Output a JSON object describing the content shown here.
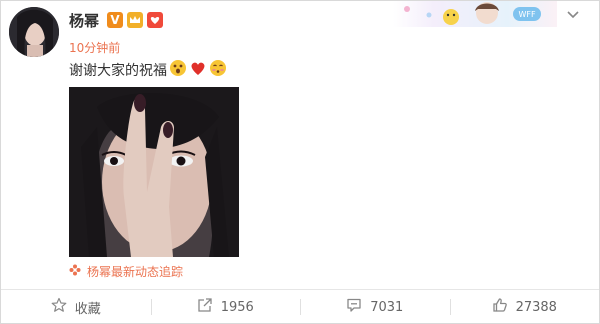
{
  "post": {
    "username": "杨幂",
    "verified_badge": "V",
    "timestamp": "10分钟前",
    "content_text": "谢谢大家的祝福",
    "emojis": [
      "shocked-face-emoji",
      "heart-emoji",
      "shy-face-emoji"
    ],
    "topic_text": "杨幂最新动态追踪"
  },
  "actions": {
    "favorite": "收藏",
    "repost": "1956",
    "comment": "7031",
    "like": "27388"
  },
  "colors": {
    "accent": "#eb7350",
    "verified": "#f08c1c",
    "heart": "#e0302a",
    "divider": "#e6e6e6",
    "action_text": "#666666"
  },
  "icons": [
    "chevron-down-icon",
    "star-icon",
    "repost-icon",
    "comment-icon",
    "thumbs-up-icon",
    "topic-flower-icon"
  ]
}
